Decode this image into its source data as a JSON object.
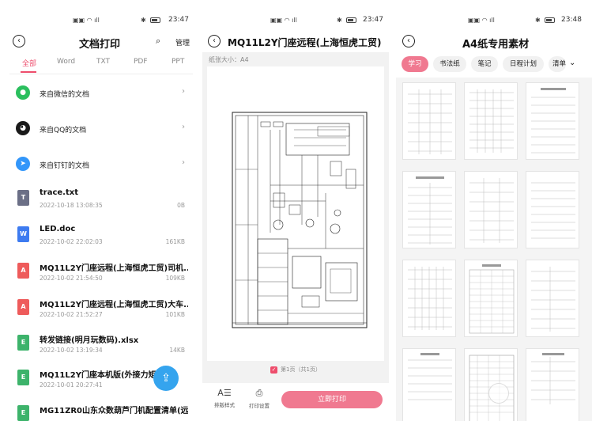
{
  "panel1": {
    "status_time": "23:47",
    "title": "文档打印",
    "manage": "管理",
    "tabs": [
      "全部",
      "Word",
      "TXT",
      "PDF",
      "PPT"
    ],
    "sources": [
      {
        "label": "来自微信的文档",
        "icon": "wechat-icon",
        "color": "#2bbf5e"
      },
      {
        "label": "来自QQ的文档",
        "icon": "qq-icon",
        "color": "#1a1a1a"
      },
      {
        "label": "来自钉钉的文档",
        "icon": "dingtalk-icon",
        "color": "#3296fa"
      }
    ],
    "files": [
      {
        "name": "trace.txt",
        "date": "2022-10-18 13:08:35",
        "size": "0B",
        "type": "T",
        "color": "#6b6f86"
      },
      {
        "name": "LED.doc",
        "date": "2022-10-02 22:02:03",
        "size": "161KB",
        "type": "W",
        "color": "#3d7bf0"
      },
      {
        "name": "MQ11L2Y门座远程(上海恒虎工贸)司机...",
        "date": "2022-10-02 21:54:50",
        "size": "109KB",
        "type": "A",
        "color": "#ee5b5b"
      },
      {
        "name": "MQ11L2Y门座远程(上海恒虎工贸)大车...",
        "date": "2022-10-02 21:52:27",
        "size": "101KB",
        "type": "A",
        "color": "#ee5b5b"
      },
      {
        "name": "转发链接(明月玩数码).xlsx",
        "date": "2022-10-02 13:19:34",
        "size": "14KB",
        "type": "E",
        "color": "#3db36b"
      },
      {
        "name": "MQ11L2Y门座本机版(外接力矩限...",
        "date": "2022-10-01 20:27:41",
        "size": "",
        "type": "E",
        "color": "#3db36b"
      },
      {
        "name": "MG11ZR0山东众数葫芦门机配置清单(远...",
        "date": "",
        "size": "",
        "type": "E",
        "color": "#3db36b"
      }
    ]
  },
  "panel2": {
    "status_time": "23:47",
    "title": "MQ11L2Y门座远程(上海恒虎工贸)",
    "paper_size": "纸张大小：A4",
    "page_indicator": "第1页（共1页）",
    "tool_layout": "排版样式",
    "tool_settings": "打印设置",
    "print_button": "立即打印"
  },
  "panel3": {
    "status_time": "23:48",
    "title": "A4纸专用素材",
    "tabs": [
      "学习",
      "书法纸",
      "笔记",
      "日程计划",
      "清单"
    ]
  },
  "colors": {
    "accent": "#ee4d6c",
    "print_button": "#f07990",
    "fab": "#35a4ee"
  }
}
